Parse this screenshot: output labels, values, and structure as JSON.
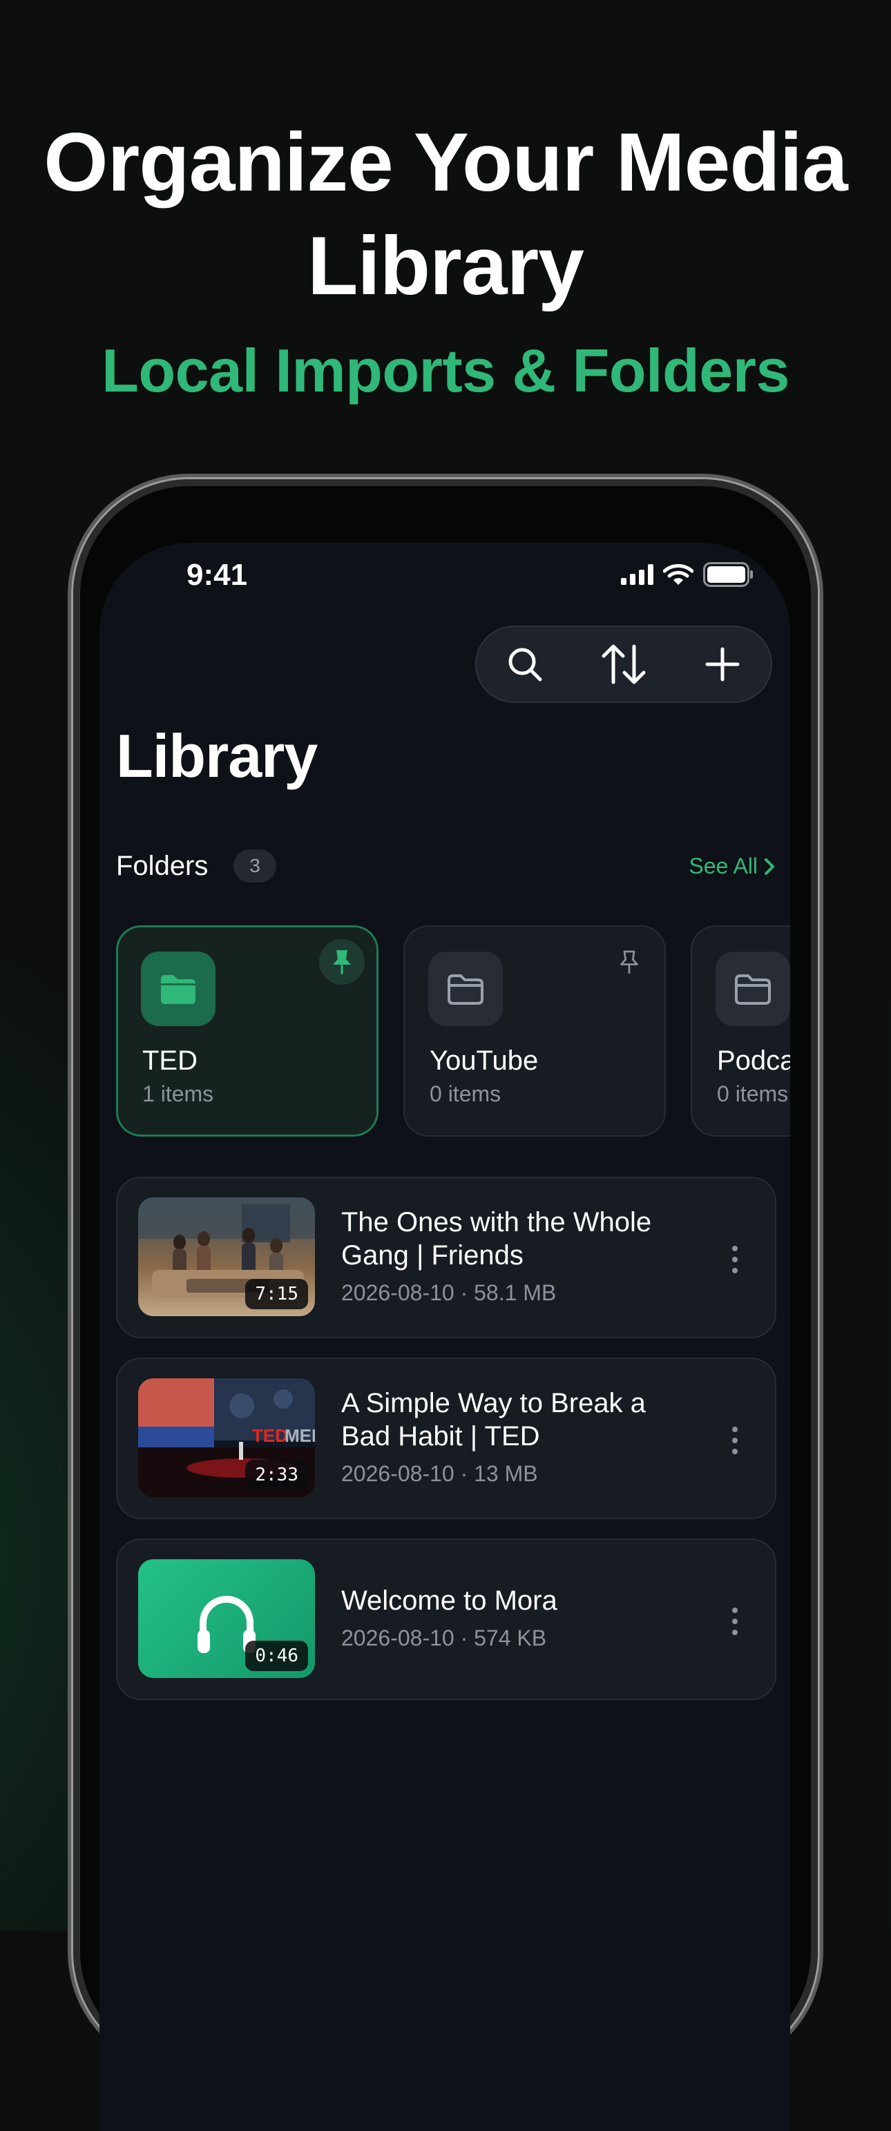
{
  "hero": {
    "title": "Organize Your Media Library",
    "subtitle": "Local Imports & Folders"
  },
  "status_bar": {
    "time": "9:41"
  },
  "toolbar": {
    "icons": [
      "search-icon",
      "sort-icon",
      "plus-icon"
    ]
  },
  "library": {
    "title": "Library",
    "folders_label": "Folders",
    "folders_count": "3",
    "see_all": "See All",
    "folders": [
      {
        "name": "TED",
        "items": "1 items",
        "pinned": true
      },
      {
        "name": "YouTube",
        "items": "0 items",
        "pinned": false
      },
      {
        "name": "Podcasts",
        "items": "0 items",
        "pinned": false
      }
    ],
    "media": [
      {
        "title": "The Ones with the Whole Gang | Friends",
        "meta": "2026-08-10 · 58.1 MB",
        "duration": "7:15",
        "thumbnail": "video-thumbnail"
      },
      {
        "title": "A Simple Way to Break a Bad Habit | TED",
        "meta": "2026-08-10 · 13 MB",
        "duration": "2:33",
        "thumbnail": "video-thumbnail"
      },
      {
        "title": "Welcome to Mora",
        "meta": "2026-08-10 · 574 KB",
        "duration": "0:46",
        "thumbnail": "headphones-icon"
      }
    ]
  },
  "colors": {
    "accent": "#2fb877",
    "background": "#0e1117",
    "card": "#171b22"
  }
}
